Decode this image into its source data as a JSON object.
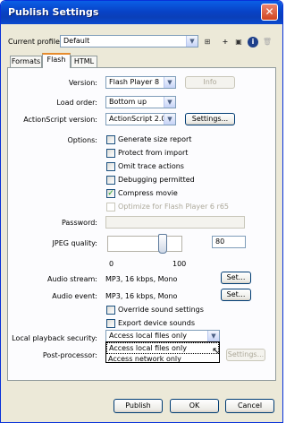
{
  "window": {
    "title": "Publish Settings",
    "close_label": "✕"
  },
  "profile": {
    "label": "Current profile:",
    "value": "Default",
    "tools": [
      "⊞",
      "+",
      "▣",
      "i",
      "🗑"
    ]
  },
  "tabs": [
    "Formats",
    "Flash",
    "HTML"
  ],
  "flash": {
    "version": {
      "label": "Version:",
      "value": "Flash Player 8",
      "info_button": "Info"
    },
    "load_order": {
      "label": "Load order:",
      "value": "Bottom up"
    },
    "actionscript": {
      "label": "ActionScript version:",
      "value": "ActionScript 2.0",
      "settings_button": "Settings..."
    },
    "options": {
      "label": "Options:",
      "items": [
        {
          "label": "Generate size report",
          "checked": false,
          "enabled": true
        },
        {
          "label": "Protect from import",
          "checked": false,
          "enabled": true
        },
        {
          "label": "Omit trace actions",
          "checked": false,
          "enabled": true
        },
        {
          "label": "Debugging permitted",
          "checked": false,
          "enabled": true
        },
        {
          "label": "Compress movie",
          "checked": true,
          "enabled": true
        },
        {
          "label": "Optimize for Flash Player 6 r65",
          "checked": false,
          "enabled": false
        }
      ]
    },
    "password": {
      "label": "Password:",
      "value": ""
    },
    "jpeg": {
      "label": "JPEG quality:",
      "value": "80",
      "min": "0",
      "max": "100",
      "level": 80
    },
    "audio_stream": {
      "label": "Audio stream:",
      "value": "MP3, 16 kbps, Mono",
      "button": "Set..."
    },
    "audio_event": {
      "label": "Audio event:",
      "value": "MP3, 16 kbps, Mono",
      "button": "Set..."
    },
    "override_sound": {
      "label": "Override sound settings",
      "checked": false
    },
    "export_device": {
      "label": "Export device sounds",
      "checked": false
    },
    "local_playback": {
      "label": "Local playback security:",
      "value": "Access local files only",
      "options": [
        "Access local files only",
        "Access network only"
      ]
    },
    "post_processor": {
      "label": "Post-processor:",
      "settings_button": "Settings..."
    }
  },
  "footer": {
    "publish": "Publish",
    "ok": "OK",
    "cancel": "Cancel"
  }
}
